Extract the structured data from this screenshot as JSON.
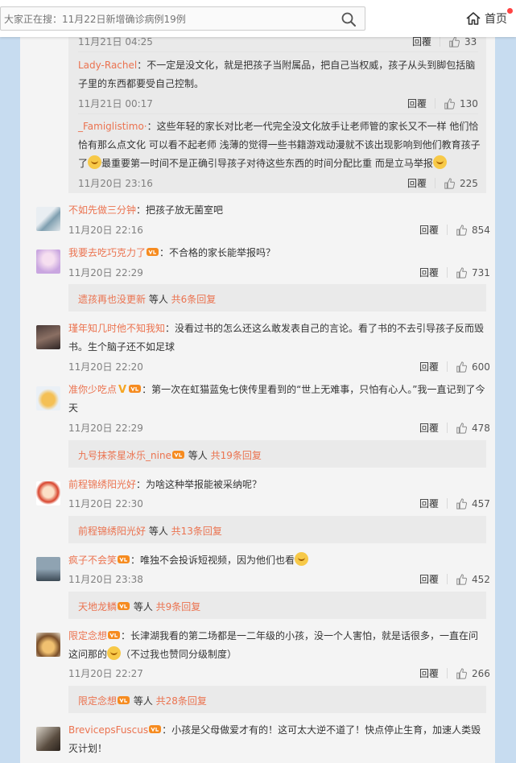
{
  "search": {
    "placeholder": "大家正在搜：11月22日新增确诊病例19例"
  },
  "home": {
    "label": "首页"
  },
  "actions": {
    "reply": "回覆"
  },
  "nested": [
    {
      "time": "11月21日 04:25",
      "likes": "33"
    },
    {
      "user": "Lady-Rachel",
      "text": "：不一定是没文化，就是把孩子当附属品，把自己当权威，孩子从头到脚包括脑子里的东西都要受自己控制。",
      "time": "11月21日 00:17",
      "likes": "130"
    },
    {
      "user": "_Famiglistimo·",
      "text1": "：这些年轻的家长对比老一代完全没文化放手让老师管的家长又不一样 他们恰恰有那么点文化 可以看不起老师 浅薄的觉得一些书籍游戏动漫就不该出现影响到他们教育孩子了",
      "text2": "最重要第一时间不是正确引导孩子对待这些东西的时间分配比重 而是立马举报",
      "time": "11月20日 23:16",
      "likes": "225"
    }
  ],
  "comments": [
    {
      "user": "不如先做三分钟",
      "text": "：把孩子放无菌室吧",
      "time": "11月20日 22:16",
      "likes": "854"
    },
    {
      "user": "我要去吃巧克力了",
      "text": "：不合格的家长能举报吗？",
      "time": "11月20日 22:29",
      "likes": "731",
      "more_user": "遗孩再也没更新",
      "more_mid": " 等人 ",
      "more_count": "共6条回复"
    },
    {
      "user": "瑾年知几时他不知我知",
      "text": "：没看过书的怎么还这么敢发表自己的言论。看了书的不去引导孩子反而毁书。生个脑子还不如足球",
      "time": "11月20日 22:20",
      "likes": "600"
    },
    {
      "user": "准你少吃点",
      "text": "：第一次在虹猫蓝兔七侠传里看到的“世上无难事，只怕有心人。”我一直记到了今天",
      "time": "11月20日 22:29",
      "likes": "478",
      "more_user": "九号抹茶星冰乐_nine",
      "more_mid": " 等人 ",
      "more_count": "共19条回复"
    },
    {
      "user": "前程锦绣阳光好",
      "text": "：为啥这种举报能被采纳呢？",
      "time": "11月20日 22:30",
      "likes": "457",
      "more_user": "前程锦绣阳光好",
      "more_mid": " 等人 ",
      "more_count": "共13条回复"
    },
    {
      "user": "疯子不会笑",
      "text": "：唯独不会投诉短视频，因为他们也看",
      "time": "11月20日 23:38",
      "likes": "452",
      "more_user": "天地龙鳞",
      "more_mid": " 等人 ",
      "more_count": "共9条回复"
    },
    {
      "user": "限定念想",
      "text1": "：长津湖我看的第二场都是一二年级的小孩，没一个人害怕，就是话很多，一直在问这问那的",
      "text2": "（不过我也赞同分级制度）",
      "time": "11月20日 22:27",
      "likes": "266",
      "more_user": "限定念想",
      "more_mid": " 等人 ",
      "more_count": "共28条回复"
    },
    {
      "user": "BrevicepsFuscus",
      "text": "：小孩是父母做爱才有的！这可太大逆不道了！快点停止生育，加速人类毁灭计划！"
    }
  ]
}
